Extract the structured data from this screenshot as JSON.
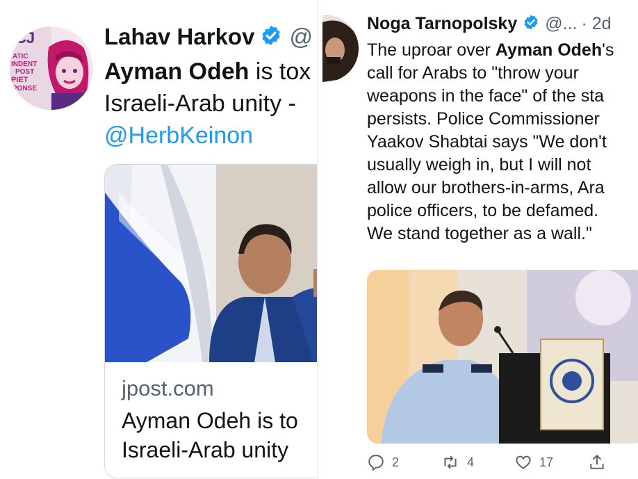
{
  "left_tweet": {
    "author_name": "Lahav Harkov",
    "handle": "@",
    "line1_bold": "Ayman Odeh",
    "line1_rest": " is tox",
    "line2": "Israeli-Arab unity - ",
    "mention": "@HerbKeinon",
    "card": {
      "domain": "jpost.com",
      "title_line1": "Ayman Odeh is to",
      "title_line2": "Israeli-Arab unity"
    },
    "avatar_text": [
      "CJ",
      "ATIC",
      "INDENT",
      "POST",
      "PIET",
      "PONSE"
    ]
  },
  "right_tweet": {
    "author_name": "Noga Tarnopolsky",
    "handle": "@...",
    "time": "· 2d",
    "body": [
      {
        "pre": "The uproar over ",
        "bold": "Ayman Odeh",
        "post": "'s"
      },
      {
        "pre": "call for Arabs to \"throw your",
        "bold": "",
        "post": ""
      },
      {
        "pre": "weapons in the face\" of the sta",
        "bold": "",
        "post": ""
      },
      {
        "pre": "persists. Police Commissioner",
        "bold": "",
        "post": ""
      },
      {
        "pre": "Yaakov Shabtai says \"We don't",
        "bold": "",
        "post": ""
      },
      {
        "pre": "usually weigh in, but I will not",
        "bold": "",
        "post": ""
      },
      {
        "pre": "allow our brothers-in-arms, Ara",
        "bold": "",
        "post": ""
      },
      {
        "pre": "police officers, to be defamed.",
        "bold": "",
        "post": ""
      },
      {
        "pre": "We stand together as a wall.\"",
        "bold": "",
        "post": ""
      }
    ],
    "actions": {
      "replies": "2",
      "retweets": "4",
      "likes": "17"
    }
  },
  "colors": {
    "link": "#1d9bf0",
    "verified": "#1d9bf0",
    "secondary_text": "#536471",
    "primary_text": "#0f1419"
  }
}
